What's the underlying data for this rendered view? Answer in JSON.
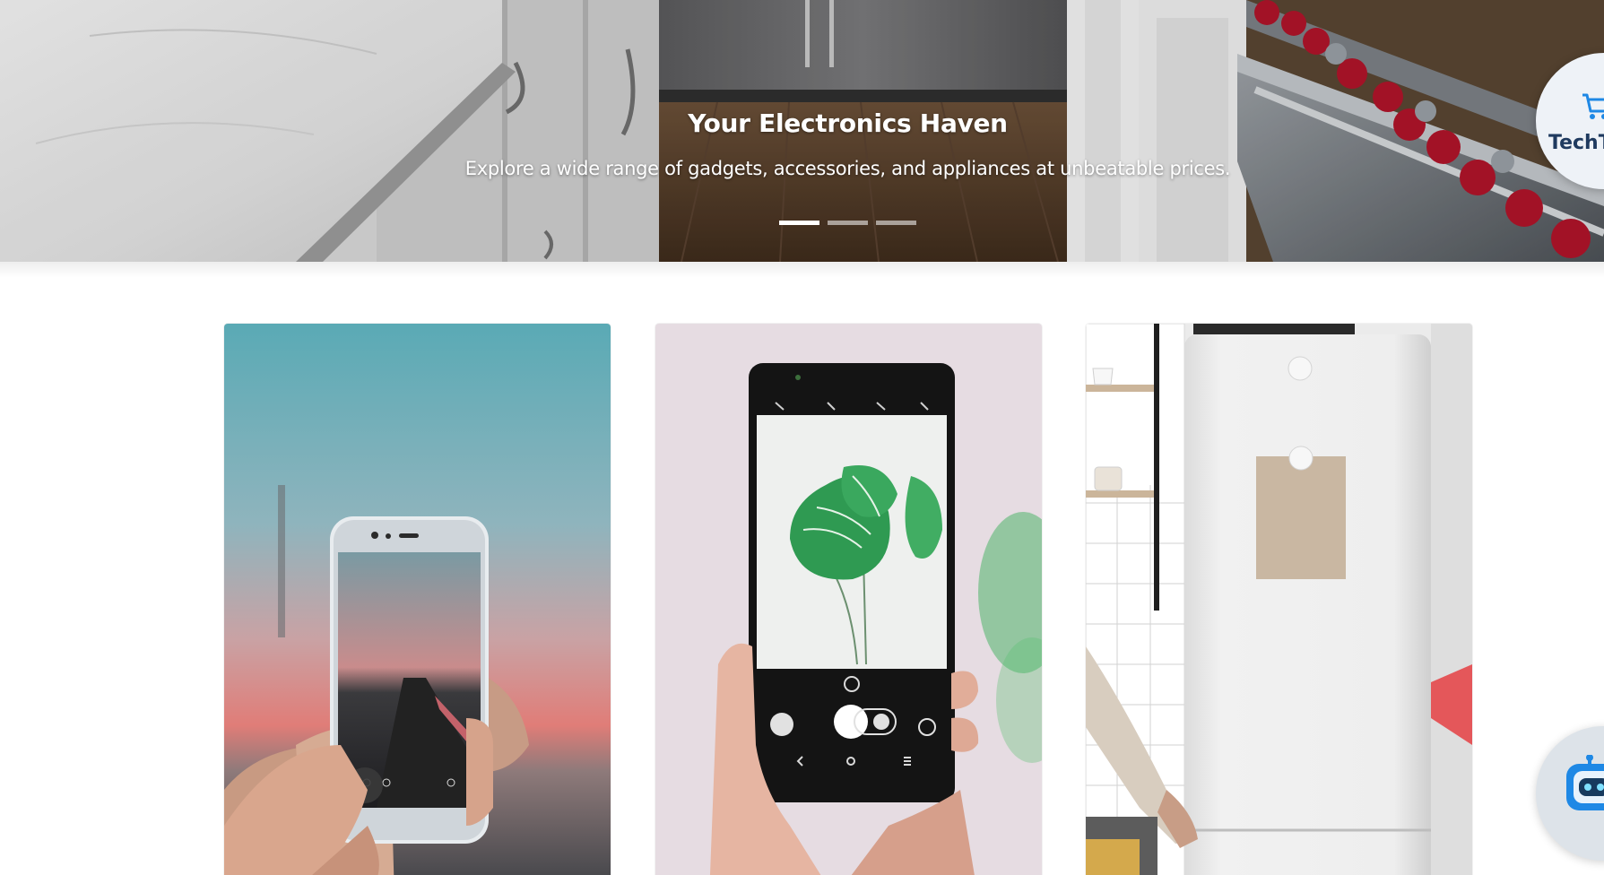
{
  "hero": {
    "title": "Your Electronics Haven",
    "subtitle": "Explore a wide range of gadgets, accessories, and appliances at unbeatable prices.",
    "slides": [
      {
        "label": "Slide 1",
        "active": true
      },
      {
        "label": "Slide 2",
        "active": false
      },
      {
        "label": "Slide 3",
        "active": false
      }
    ]
  },
  "brand": {
    "name": "TechT",
    "icon": "shopping-cart-icon"
  },
  "chatbot": {
    "icon": "robot-icon"
  },
  "products": [
    {
      "image": "phone-camera-sunset",
      "alt": "Hand holding a smartphone photographing a sunset road"
    },
    {
      "image": "phone-camera-leaf",
      "alt": "Hand holding a smartphone photographing a green leaf"
    },
    {
      "image": "white-refrigerator",
      "alt": "Person opening a white refrigerator in a tiled kitchen"
    }
  ],
  "colors": {
    "accent": "#1f3a5f",
    "hero_text": "#ffffff",
    "knob_red": "#b0142a"
  }
}
